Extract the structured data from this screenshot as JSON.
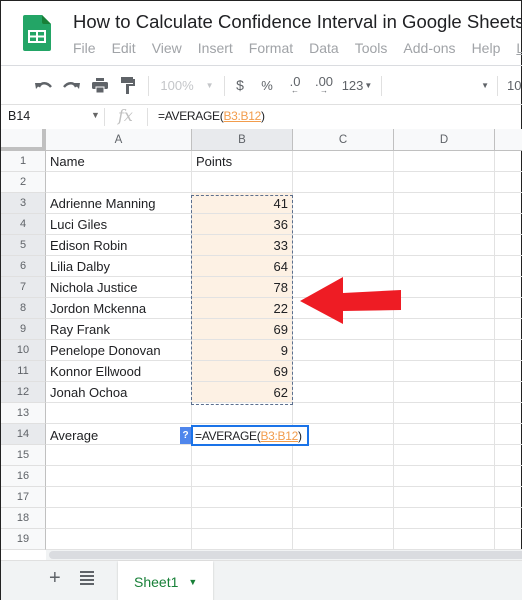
{
  "app": {
    "title": "How to Calculate Confidence Interval in Google Sheets",
    "logo": "google-sheets-logo",
    "menu": [
      "File",
      "Edit",
      "View",
      "Insert",
      "Format",
      "Data",
      "Tools",
      "Add-ons",
      "Help",
      "L"
    ]
  },
  "toolbar": {
    "undo_icon": "undo-icon",
    "redo_icon": "redo-icon",
    "print_icon": "print-icon",
    "paint_format_icon": "paint-format-icon",
    "zoom": "100%",
    "currency": "$",
    "percent": "%",
    "decrease_decimal": ".0",
    "increase_decimal": ".00",
    "more_formats": "123",
    "font_size": "10"
  },
  "formula_bar": {
    "name_box": "B14",
    "fx": "fx",
    "formula_prefix": "=AVERAGE(",
    "formula_ref": "B3:B12",
    "formula_suffix": ")"
  },
  "grid": {
    "columns": [
      "A",
      "B",
      "C",
      "D"
    ],
    "rows": [
      "1",
      "2",
      "3",
      "4",
      "5",
      "6",
      "7",
      "8",
      "9",
      "10",
      "11",
      "12",
      "13",
      "14",
      "15",
      "16",
      "17",
      "18",
      "19"
    ],
    "header": {
      "name": "Name",
      "points": "Points"
    },
    "data": [
      {
        "name": "Adrienne Manning",
        "points": "41"
      },
      {
        "name": "Luci Giles",
        "points": "36"
      },
      {
        "name": "Edison Robin",
        "points": "33"
      },
      {
        "name": "Lilia Dalby",
        "points": "64"
      },
      {
        "name": "Nichola Justice",
        "points": "78"
      },
      {
        "name": "Jordon Mckenna",
        "points": "22"
      },
      {
        "name": "Ray Frank",
        "points": "69"
      },
      {
        "name": "Penelope Donovan",
        "points": "9"
      },
      {
        "name": "Konnor Ellwood",
        "points": "69"
      },
      {
        "name": "Jonah Ochoa",
        "points": "62"
      }
    ],
    "average_label": "Average",
    "active_cell": "B14",
    "editor": {
      "badge": "?",
      "prefix": "=AVERAGE(",
      "ref": "B3:B12",
      "suffix": ")"
    }
  },
  "annotation": {
    "arrow_color": "#ee1c24",
    "arrow_direction": "left"
  },
  "bottom": {
    "add_sheet": "+",
    "sheet_tab": "Sheet1"
  },
  "colors": {
    "brand_green": "#23a566",
    "range_highlight": "#fdf1e4",
    "reference": "#f29c4c",
    "active_border": "#1a73e8"
  }
}
